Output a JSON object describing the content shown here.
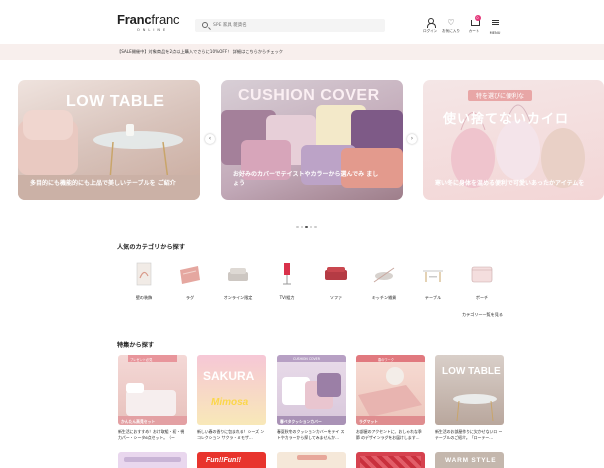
{
  "header": {
    "logo_main_bold": "Franc",
    "logo_main_light": "franc",
    "logo_sub": "ONLINE",
    "search_placeholder": "SPE 家具 雑貨名",
    "nav": [
      {
        "label": "ログイン",
        "icon": "user-icon"
      },
      {
        "label": "お気に入り",
        "icon": "heart-icon"
      },
      {
        "label": "カート",
        "icon": "cart-icon",
        "badge": "0"
      },
      {
        "label": "MENU",
        "icon": "menu-icon"
      }
    ]
  },
  "notice": {
    "text": "【SALE開催中】対象商品を2点以上購入でさらに10%OFF！ 詳細はこちらからチェック"
  },
  "carousel": {
    "slides": [
      {
        "title": "LOW TABLE",
        "caption": "多目的にも機能的にも上品で美しいテーブルを ご紹介"
      },
      {
        "title": "CUSHION COVER",
        "caption": "お好みのカバーでテイストやカラーから選んでみ ましょう"
      },
      {
        "title": "使い捨てないカイロ",
        "tag": "特を選びに便利な",
        "caption": "寒い冬に身体を温める便利で可愛いあったかアイテムを"
      }
    ],
    "prev": "‹",
    "next": "›",
    "dot_count": 5,
    "active_dot": 3
  },
  "categories": {
    "title": "人気のカテゴリから探す",
    "items": [
      {
        "label": "壁の装飾",
        "icon": "wall-art-icon"
      },
      {
        "label": "ラグ",
        "icon": "rug-icon"
      },
      {
        "label": "オンライン限定",
        "icon": "online-limited-icon"
      },
      {
        "label": "TV/組力",
        "icon": "tv-stand-icon"
      },
      {
        "label": "ソファ",
        "icon": "sofa-icon"
      },
      {
        "label": "キッチン雑貨",
        "icon": "kitchen-icon"
      },
      {
        "label": "テーブル",
        "icon": "table-icon"
      },
      {
        "label": "ポーチ",
        "icon": "pouch-icon"
      }
    ],
    "more": "カテゴリー一覧を見る"
  },
  "features": {
    "title": "特集から探す",
    "cards": [
      {
        "top_tag": "プレゼント必見",
        "band": "かんたん高見セット",
        "desc": "新生活におすすめ！おけ取組・初・視力パー・シータ6点セット。（ー"
      },
      {
        "word": "SAKURA",
        "word2": "Mimosa",
        "desc": "新しい春の香りに包まれる！シーズ ンコレクション サクラ・ミモザ…"
      },
      {
        "top_tag": "CUSHION COVER",
        "band": "春ぺタクッションカバー",
        "desc": "春夏秋冬のクッションカバーをテイ ストやカラーから探してみませんか…"
      },
      {
        "top_tag": "春のワーク",
        "band": "ラグマット",
        "desc": "お部屋のアクセントに、おしゃれな季節 のデザインラグをお届けします…"
      },
      {
        "word": "LOW TABLE",
        "desc": "新生活のお部屋作りに欠かせないロ ーテーブルのご紹介。「ローテー…"
      }
    ],
    "row2": [
      {
        "word": ""
      },
      {
        "word": "Fun!!Fun!!"
      },
      {
        "word": ""
      },
      {
        "word": ""
      },
      {
        "word": "WARM STYLE"
      }
    ]
  }
}
